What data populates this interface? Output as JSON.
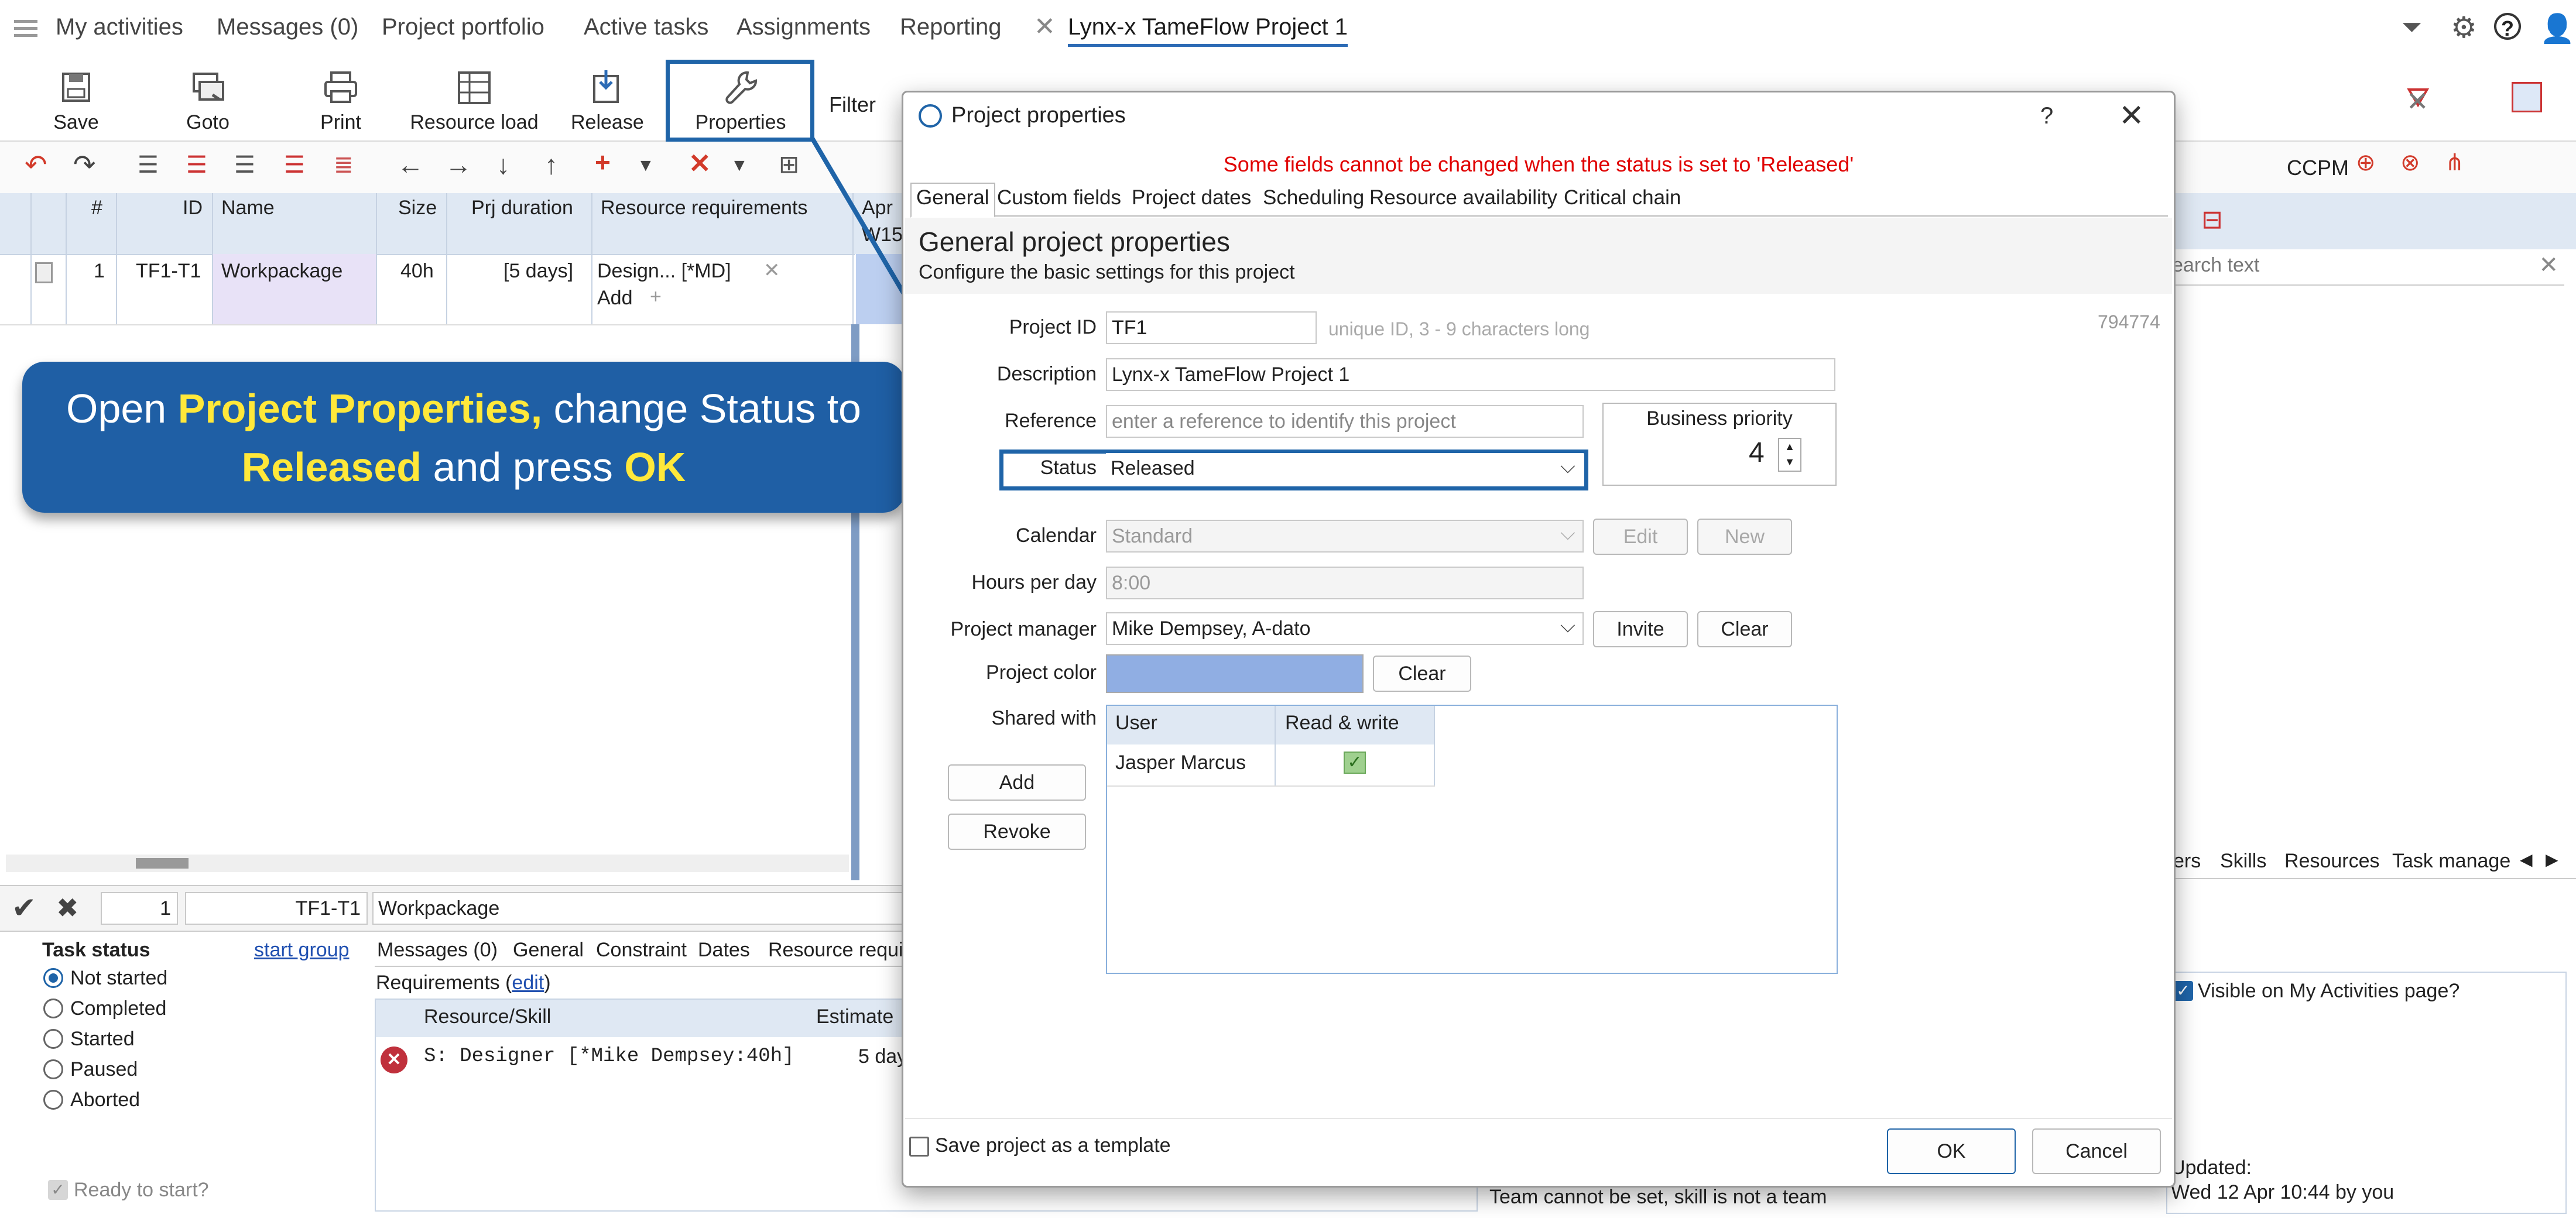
{
  "nav": {
    "items": [
      "My activities",
      "Messages (0)",
      "Project portfolio",
      "Active tasks",
      "Assignments",
      "Reporting"
    ],
    "active_tab": "Lynx-x TameFlow Project 1"
  },
  "toolbar": {
    "save": "Save",
    "goto": "Goto",
    "print": "Print",
    "resource_load": "Resource load",
    "release": "Release",
    "properties": "Properties",
    "filter": "Filter",
    "ccpm": "CCPM"
  },
  "grid": {
    "headers": [
      "#",
      "ID",
      "Name",
      "Size",
      "Prj duration",
      "Resource requirements",
      "Apr",
      "W15"
    ],
    "row": {
      "num": "1",
      "id": "TF1-T1",
      "name": "Workpackage",
      "size": "40h",
      "duration": "[5 days]",
      "resource": "Design... [*MD]",
      "add": "Add"
    }
  },
  "callout": {
    "l1a": "Open ",
    "l1b": "Project Properties,",
    "l1c": " change Status to",
    "l2a": "Released",
    "l2b": " and press ",
    "l2c": "OK"
  },
  "right_panel": {
    "search_placeholder": "earch text",
    "tabs": [
      "ers",
      "Skills",
      "Resources",
      "Task manage"
    ],
    "visible_label": "Visible on My Activities page?",
    "updated_label": "Updated:",
    "updated_value": "Wed 12 Apr 10:44 by you"
  },
  "bottom": {
    "row_num": "1",
    "row_id": "TF1-T1",
    "row_name": "Workpackage",
    "task_status_label": "Task status",
    "start_group": "start group",
    "statuses": [
      "Not started",
      "Completed",
      "Started",
      "Paused",
      "Aborted"
    ],
    "ready_label": "Ready to start?",
    "tabs": [
      "Messages (0)",
      "General",
      "Constraint",
      "Dates",
      "Resource requi"
    ],
    "requirements_prefix": "Requirements (",
    "requirements_link": "edit",
    "requirements_suffix": ")",
    "col_resource": "Resource/Skill",
    "col_estimate": "Estimate",
    "req_value": "S: Designer [*Mike Dempsey:40h]",
    "req_days": "5 day",
    "team_note": "Team cannot be set, skill is not a team"
  },
  "dialog": {
    "title": "Project properties",
    "help": "?",
    "warning": "Some fields cannot be changed when the status is set to 'Released'",
    "tabs": [
      "General",
      "Custom fields",
      "Project dates",
      "Scheduling",
      "Resource availability",
      "Critical chain"
    ],
    "heading": "General project properties",
    "subheading": "Configure the basic settings for this project",
    "record_id": "794774",
    "project_id_label": "Project ID",
    "project_id": "TF1",
    "project_id_hint": "unique ID, 3 - 9 characters long",
    "description_label": "Description",
    "description": "Lynx-x TameFlow Project 1",
    "reference_label": "Reference",
    "reference_placeholder": "enter a reference to identify this project",
    "business_priority_label": "Business priority",
    "business_priority": "4",
    "status_label": "Status",
    "status": "Released",
    "calendar_label": "Calendar",
    "calendar": "Standard",
    "edit": "Edit",
    "new": "New",
    "hours_label": "Hours per day",
    "hours": "8:00",
    "pm_label": "Project manager",
    "pm": "Mike Dempsey, A-dato",
    "invite": "Invite",
    "clear": "Clear",
    "color_label": "Project color",
    "color_value": "#90aee3",
    "color_clear": "Clear",
    "shared_label": "Shared with",
    "add": "Add",
    "revoke": "Revoke",
    "share_col_user": "User",
    "share_col_rw": "Read & write",
    "share_user": "Jasper Marcus",
    "template_label": "Save project as a template",
    "ok": "OK",
    "cancel": "Cancel"
  },
  "colors": {
    "accent": "#1f64a8",
    "callout_bg": "#1f5fa5",
    "highlight_text": "#ffe83a",
    "warning": "#e00000"
  }
}
